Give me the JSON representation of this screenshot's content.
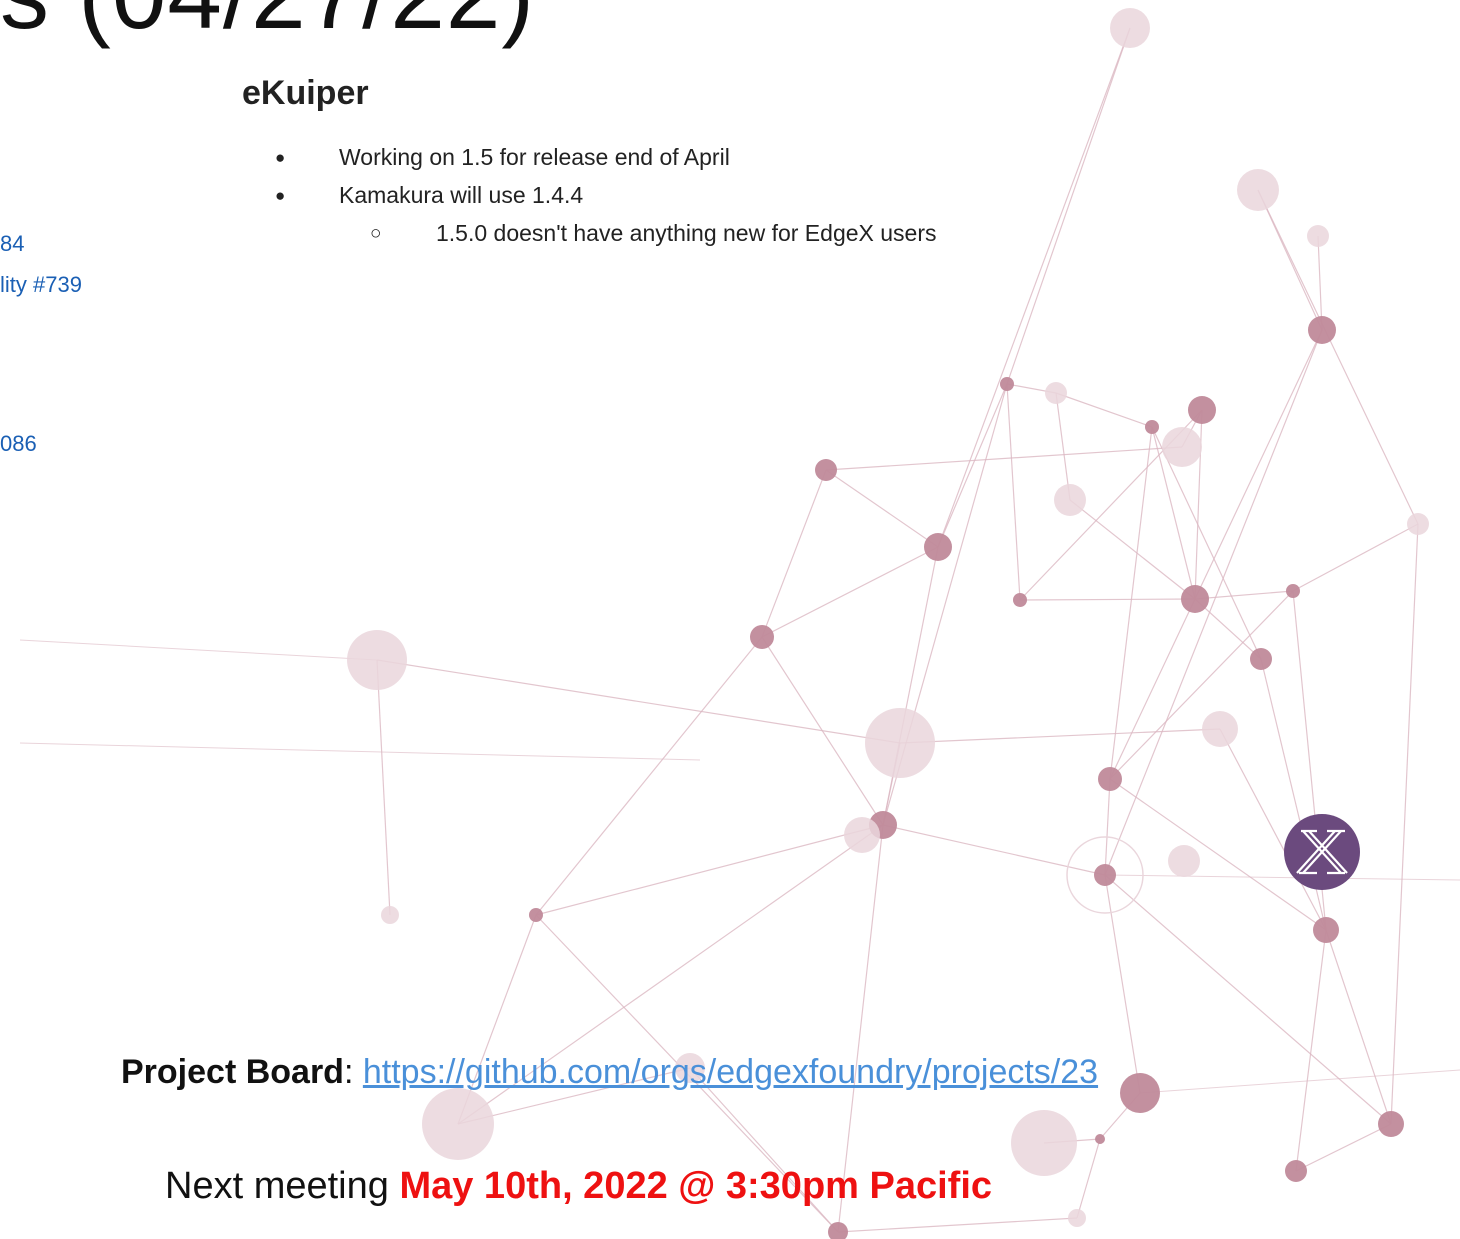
{
  "title_fragment": "s (04/27/22)",
  "left_fragments": [
    "84",
    "lity #739",
    "086"
  ],
  "section": {
    "heading": "eKuiper",
    "bullets": [
      {
        "text": "Working on 1.5 for release end of April",
        "level": 1,
        "marker": "●"
      },
      {
        "text": "Kamakura will use 1.4.4",
        "level": 1,
        "marker": "●"
      },
      {
        "text": "1.5.0 doesn't have anything new for EdgeX users",
        "level": 2,
        "marker": "○"
      }
    ]
  },
  "project_board": {
    "label": "Project Board",
    "separator": ": ",
    "url": "https://github.com/orgs/edgexfoundry/projects/23"
  },
  "next_meeting": {
    "prefix": "Next meeting ",
    "date_time": "May 10th, 2022 @  3:30pm Pacific"
  },
  "colors": {
    "node": "#c08a9a",
    "node_light": "#ead6dc",
    "line": "#dcb8c3",
    "link": "#1a5fb4",
    "url": "#4a90d9",
    "accent": "#ee1111",
    "logo": "#6b4a7e"
  },
  "logo_icon": "edgex-x-logo-icon"
}
